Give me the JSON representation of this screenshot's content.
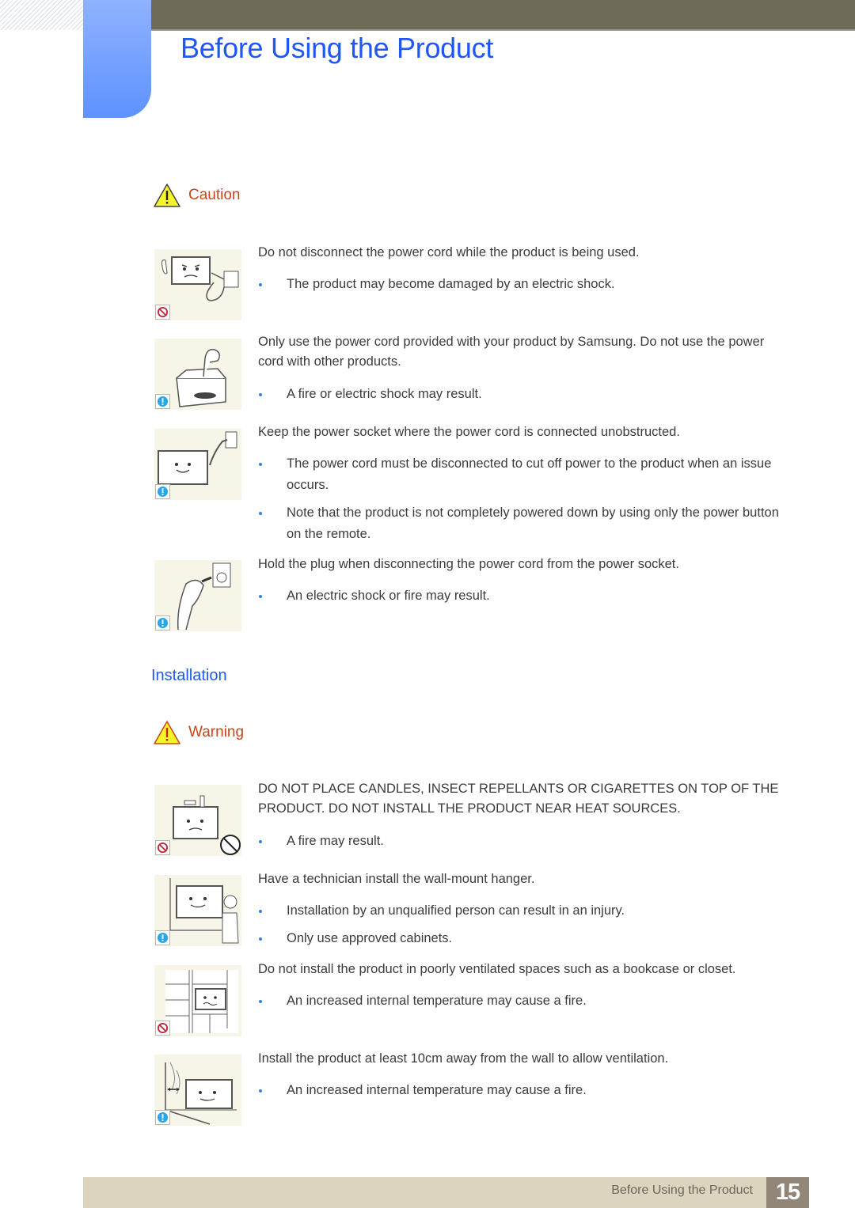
{
  "header": {
    "title": "Before Using the Product"
  },
  "caution": {
    "icon": "warning-triangle-icon",
    "label": "Caution",
    "items": [
      {
        "illustration": "disconnect-cord-in-use",
        "badge": "prohibited-icon",
        "text": "Do not disconnect the power cord while the product is being used.",
        "bullets": [
          "The product may become damaged by an electric shock."
        ]
      },
      {
        "illustration": "samsung-power-cord-box",
        "badge": "info-icon",
        "text": "Only use the power cord provided with your product by Samsung. Do not use the power cord with other products.",
        "bullets": [
          "A fire or electric shock may result."
        ]
      },
      {
        "illustration": "unobstructed-socket",
        "badge": "info-icon",
        "text": "Keep the power socket where the power cord is connected unobstructed.",
        "bullets": [
          "The power cord must be disconnected to cut off power to the product when an issue occurs.",
          "Note that the product is not completely powered down by using only the power button on the remote."
        ]
      },
      {
        "illustration": "hold-plug",
        "badge": "info-icon",
        "text": "Hold the plug when disconnecting the power cord from the power socket.",
        "bullets": [
          "An electric shock or fire may result."
        ]
      }
    ]
  },
  "installation": {
    "heading": "Installation",
    "warning": {
      "icon": "warning-triangle-icon",
      "label": "Warning"
    },
    "items": [
      {
        "illustration": "candles-on-product",
        "badge": "prohibited-icon",
        "text": "DO NOT PLACE CANDLES, INSECT REPELLANTS OR CIGARETTES ON TOP OF THE PRODUCT. DO NOT INSTALL THE PRODUCT NEAR HEAT SOURCES.",
        "bullets": [
          "A fire may result."
        ]
      },
      {
        "illustration": "technician-wall-mount",
        "badge": "info-icon",
        "text": "Have a technician install the wall-mount hanger.",
        "bullets": [
          "Installation by an unqualified person can result in an injury.",
          "Only use approved cabinets."
        ]
      },
      {
        "illustration": "bookcase-installation",
        "badge": "prohibited-icon",
        "text": "Do not install the product in poorly ventilated spaces such as a bookcase or closet.",
        "bullets": [
          "An increased internal temperature may cause a fire."
        ]
      },
      {
        "illustration": "wall-distance",
        "badge": "info-icon",
        "text": "Install the product at least 10cm away from the wall to allow ventilation.",
        "bullets": [
          "An increased internal temperature may cause a fire."
        ]
      }
    ]
  },
  "footer": {
    "section_title": "Before Using the Product",
    "page_number": "15"
  },
  "colors": {
    "title_blue": "#1f57f5",
    "caution_orange": "#c8461a",
    "header_bar": "#6e6c59",
    "footer_bar": "#dbd5c0",
    "page_number_bg": "#918677",
    "bullet_blue": "#3a7fe0"
  }
}
